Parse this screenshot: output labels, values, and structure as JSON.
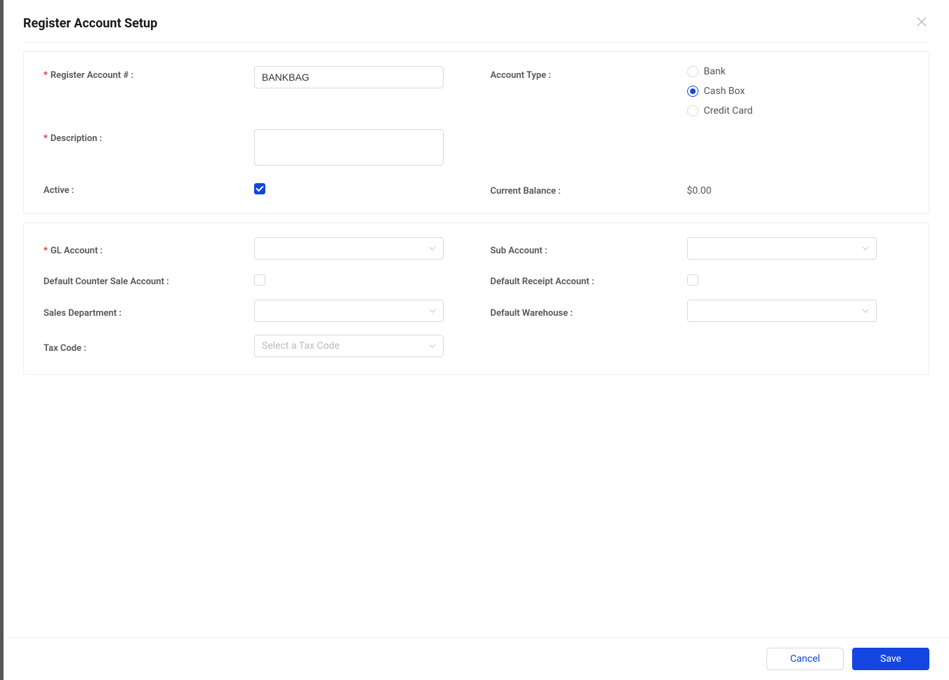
{
  "header": {
    "title": "Register Account Setup"
  },
  "panel1": {
    "register_account_label": "Register Account # :",
    "register_account_value": "BANKBAG",
    "description_label": "Description :",
    "description_value": "",
    "account_type_label": "Account Type :",
    "account_type_options": {
      "bank": "Bank",
      "cash_box": "Cash Box",
      "credit_card": "Credit Card"
    },
    "account_type_selected": "cash_box",
    "active_label": "Active :",
    "active_checked": true,
    "current_balance_label": "Current Balance :",
    "current_balance_value": "$0.00"
  },
  "panel2": {
    "gl_account_label": "GL Account :",
    "gl_account_value": "",
    "sub_account_label": "Sub Account :",
    "sub_account_value": "",
    "default_counter_sale_label": "Default Counter Sale Account :",
    "default_counter_sale_checked": false,
    "default_receipt_label": "Default Receipt Account :",
    "default_receipt_checked": false,
    "sales_department_label": "Sales Department :",
    "sales_department_value": "",
    "default_warehouse_label": "Default Warehouse :",
    "default_warehouse_value": "",
    "tax_code_label": "Tax Code :",
    "tax_code_placeholder": "Select a Tax Code"
  },
  "footer": {
    "cancel_label": "Cancel",
    "save_label": "Save"
  }
}
